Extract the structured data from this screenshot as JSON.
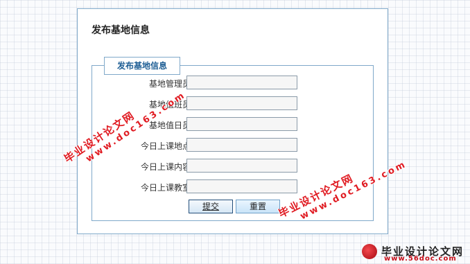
{
  "page": {
    "title": "发布基地信息"
  },
  "form": {
    "legend": "发布基地信息",
    "fields": [
      {
        "label": "基地管理员：",
        "value": ""
      },
      {
        "label": "基地值班员：",
        "value": ""
      },
      {
        "label": "基地值日员：",
        "value": ""
      },
      {
        "label": "今日上课地点：",
        "value": ""
      },
      {
        "label": "今日上课内容：",
        "value": ""
      },
      {
        "label": "今日上课教室：",
        "value": ""
      }
    ],
    "submit_label": "提交",
    "reset_label": "重置"
  },
  "watermark": {
    "text": "毕业设计论文网",
    "url": "www.doc163.com"
  },
  "footer_logo": {
    "text": "毕业设计论文网",
    "url": "www.56doc.com"
  },
  "colors": {
    "panel_border": "#7fa8c9",
    "legend_text": "#1f5f95",
    "watermark": "#e01b22"
  }
}
